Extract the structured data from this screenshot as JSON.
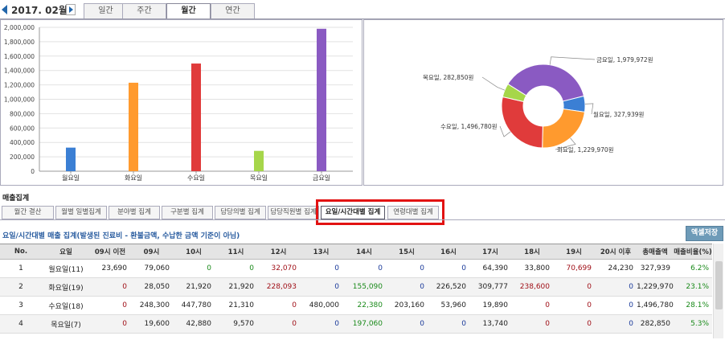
{
  "header": {
    "period": "2017. 02월",
    "tabs": [
      {
        "label": "일간",
        "active": false
      },
      {
        "label": "주간",
        "active": false
      },
      {
        "label": "월간",
        "active": true
      },
      {
        "label": "연간",
        "active": false
      }
    ]
  },
  "chart_data": [
    {
      "type": "bar",
      "title": "",
      "categories": [
        "월요일",
        "화요일",
        "수요일",
        "목요일",
        "금요일"
      ],
      "values": [
        327939,
        1229970,
        1496780,
        282850,
        1979972
      ],
      "colors": [
        "#3b7fd4",
        "#ff9a2e",
        "#e03b3b",
        "#a6d64a",
        "#8a5ac2"
      ],
      "ylim": [
        0,
        2000000
      ],
      "yticks": [
        0,
        200000,
        400000,
        600000,
        800000,
        1000000,
        1200000,
        1400000,
        1600000,
        1800000,
        2000000
      ],
      "ytick_labels": [
        "0",
        "200,000",
        "400,000",
        "600,000",
        "800,000",
        "1,000,000",
        "1,200,000",
        "1,400,000",
        "1,600,000",
        "1,800,000",
        "2,000,000"
      ],
      "grid": true
    },
    {
      "type": "pie",
      "title": "",
      "labels": [
        "월요일",
        "화요일",
        "수요일",
        "목요일",
        "금요일"
      ],
      "values": [
        327939,
        1229970,
        1496780,
        282850,
        1979972
      ],
      "data_labels": [
        "월요일, 327,939원",
        "화요일, 1,229,970원",
        "수요일, 1,496,780원",
        "목요일, 282,850원",
        "금요일, 1,979,972원"
      ],
      "colors": [
        "#3b7fd4",
        "#ff9a2e",
        "#e03b3b",
        "#a6d64a",
        "#8a5ac2"
      ]
    }
  ],
  "section": {
    "title": "매출집계",
    "tabs": [
      {
        "label": "월간 결산",
        "active": false
      },
      {
        "label": "월별 일별집계",
        "active": false
      },
      {
        "label": "분야별 집계",
        "active": false
      },
      {
        "label": "구분별 집계",
        "active": false
      },
      {
        "label": "담당의별 집계",
        "active": false
      },
      {
        "label": "담당직원별 집계",
        "active": false
      },
      {
        "label": "요일/시간대별 집계",
        "active": true
      },
      {
        "label": "연령대별 집계",
        "active": false
      }
    ],
    "report_title": "요일/시간대별 매출 집계(발생된 진료비 - 환불금액, 수납한 금액 기준이 아님)",
    "excel_button": "엑셀저장"
  },
  "table": {
    "columns": [
      "No.",
      "요일",
      "09시 이전",
      "09시",
      "10시",
      "11시",
      "12시",
      "13시",
      "14시",
      "15시",
      "16시",
      "17시",
      "18시",
      "19시",
      "20시 이후",
      "총매출액",
      "매출비율(%)"
    ],
    "rows": [
      [
        "1",
        "월요일(11)",
        "23,690",
        "79,060",
        "0",
        "0",
        "32,070",
        "0",
        "0",
        "0",
        "0",
        "64,390",
        "33,800",
        "70,699",
        "24,230",
        "327,939",
        "6.2%"
      ],
      [
        "2",
        "화요일(19)",
        "0",
        "28,050",
        "21,920",
        "21,920",
        "228,093",
        "0",
        "155,090",
        "0",
        "226,520",
        "309,777",
        "238,600",
        "0",
        "0",
        "1,229,970",
        "23.1%"
      ],
      [
        "3",
        "수요일(18)",
        "0",
        "248,300",
        "447,780",
        "21,310",
        "0",
        "480,000",
        "22,380",
        "203,160",
        "53,960",
        "19,890",
        "0",
        "0",
        "0",
        "1,496,780",
        "28.1%"
      ],
      [
        "4",
        "목요일(7)",
        "0",
        "19,600",
        "42,880",
        "9,570",
        "0",
        "0",
        "197,060",
        "0",
        "0",
        "13,740",
        "0",
        "0",
        "0",
        "282,850",
        "5.3%"
      ]
    ],
    "cell_colors": [
      [
        "c-black",
        "c-black",
        "c-black",
        "c-black",
        "c-green",
        "c-green",
        "c-darkred",
        "c-blue",
        "c-blue",
        "c-blue",
        "c-blue",
        "c-black",
        "c-black",
        "c-darkred",
        "c-black",
        "c-black",
        "c-green"
      ],
      [
        "c-black",
        "c-black",
        "c-darkred",
        "c-black",
        "c-black",
        "c-black",
        "c-darkred",
        "c-blue",
        "c-green",
        "c-blue",
        "c-black",
        "c-black",
        "c-darkred",
        "c-darkred",
        "c-blue",
        "c-black",
        "c-green"
      ],
      [
        "c-black",
        "c-black",
        "c-darkred",
        "c-black",
        "c-black",
        "c-black",
        "c-darkred",
        "c-black",
        "c-green",
        "c-black",
        "c-black",
        "c-black",
        "c-darkred",
        "c-darkred",
        "c-blue",
        "c-black",
        "c-green"
      ],
      [
        "c-black",
        "c-black",
        "c-darkred",
        "c-black",
        "c-black",
        "c-black",
        "c-darkred",
        "c-blue",
        "c-green",
        "c-blue",
        "c-blue",
        "c-black",
        "c-darkred",
        "c-darkred",
        "c-blue",
        "c-black",
        "c-green"
      ]
    ]
  }
}
